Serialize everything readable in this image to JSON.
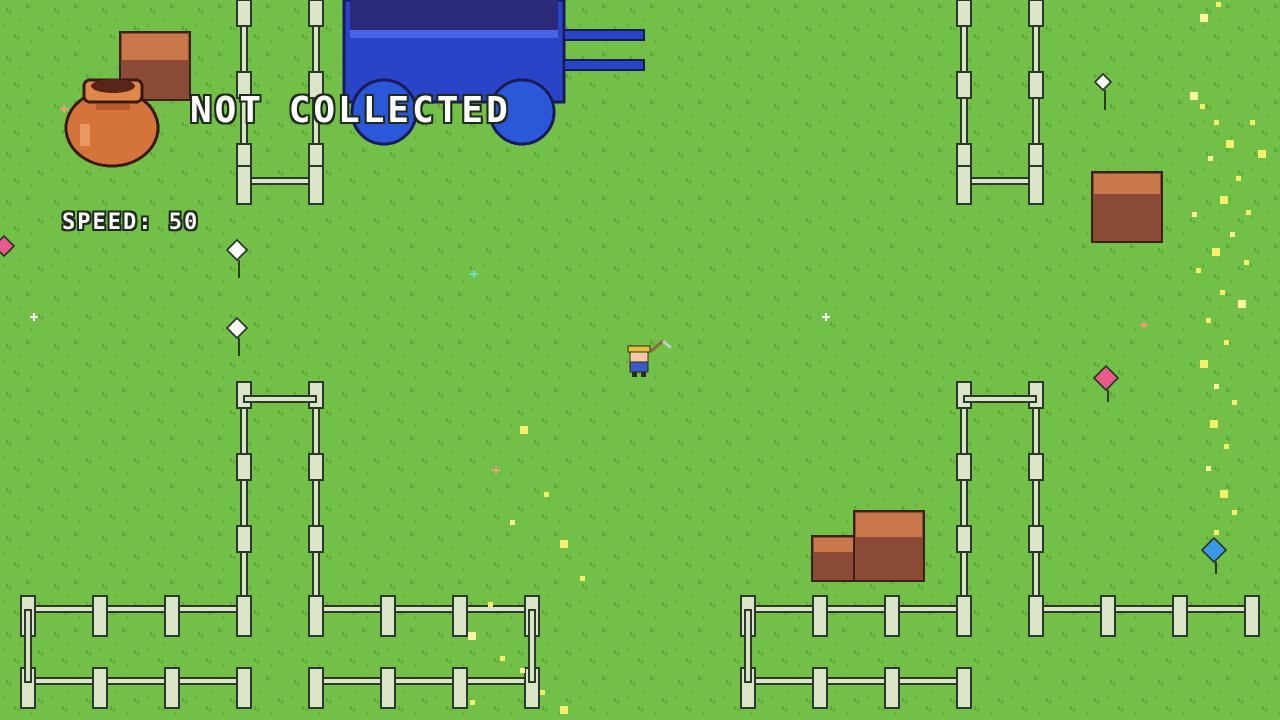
{
  "hud": {
    "collection_status": "NOT COLLECTED",
    "speed_label": "SPEED:",
    "speed_value": "50",
    "pot_icon": "clay-pot-icon"
  },
  "colors": {
    "grass": "#72c048",
    "grass_dark": "#5ea83a",
    "fence_post": "#d9e4c8",
    "fence_outline": "#2c3a2a",
    "crate_top": "#c8784a",
    "crate_side": "#8a4a36",
    "wagon_body": "#2a44c8",
    "wagon_dark": "#2a2a7a",
    "pot": "#d4733a",
    "sparkle": "#f6f06a"
  },
  "objects": {
    "player": "farmer-with-pickaxe",
    "wagon": "blue-wagon",
    "crates": [
      "crate",
      "crate",
      "crate",
      "crate"
    ],
    "flowers": [
      "white-flower",
      "white-flower",
      "white-flower",
      "pink-flower",
      "pink-flower",
      "blue-flower"
    ]
  }
}
